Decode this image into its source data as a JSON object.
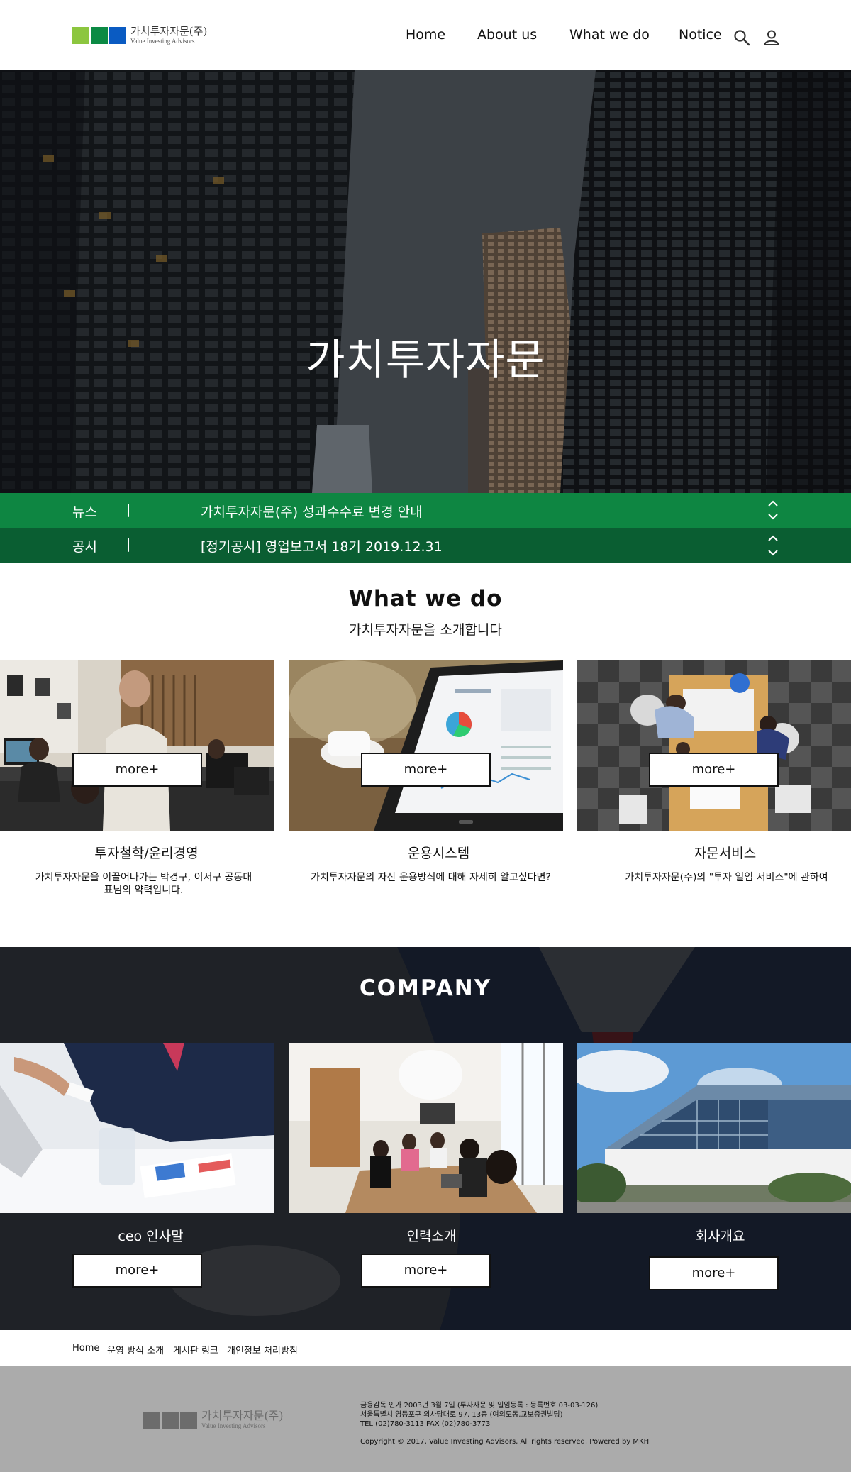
{
  "brand": {
    "logo_ko": "가치투자자문(주)",
    "logo_en": "Value Investing Advisors",
    "logo_colors": [
      "#8cc63f",
      "#0b8a44",
      "#0a5bc2"
    ]
  },
  "nav": {
    "items": [
      "Home",
      "About us",
      "What we do",
      "Notice"
    ],
    "search_icon": "search-icon",
    "user_icon": "user-icon"
  },
  "hero": {
    "title": "가치투자자문"
  },
  "ticker": [
    {
      "category": "뉴스",
      "separator": "|",
      "message": "가치투자자문(주) 성과수수료 변경 안내"
    },
    {
      "category": "공시",
      "separator": "|",
      "message": "[정기공시] 영업보고서 18기 2019.12.31"
    }
  ],
  "what_we_do": {
    "title": "What we do",
    "subtitle": "가치투자자문을 소개합니다",
    "more_label": "more+",
    "cards": [
      {
        "title": "투자철학/윤리경영",
        "desc": "가치투자자문을 이끌어나가는 박경구, 이서구 공동대표님의 약력입니다."
      },
      {
        "title": "운용시스템",
        "desc": "가치투자자문의 자산 운용방식에 대해 자세히 알고싶다면?"
      },
      {
        "title": "자문서비스",
        "desc": "가치투자자문(주)의 \"투자 일임 서비스\"에 관하여"
      }
    ]
  },
  "company": {
    "title": "COMPANY",
    "more_label": "more+",
    "cards": [
      {
        "title": "ceo 인사말"
      },
      {
        "title": "인력소개"
      },
      {
        "title": "회사개요"
      }
    ]
  },
  "footer_links": [
    "Home",
    "운영 방식 소개",
    "게시판 링크",
    "개인정보 처리방침"
  ],
  "footer": {
    "line1": "금융감독 인가 2003년 3월 7일 (투자자문 및 일임등록 : 등록번호 03-03-126)",
    "line2": "서울특별시 영등포구 의사당대로 97, 13층 (여의도동,교보증권빌딩)",
    "line3": "TEL (02)780-3113 FAX (02)780-3773",
    "copyright": "Copyright © 2017, Value Investing Advisors, All rights reserved, Powered by MKH"
  }
}
